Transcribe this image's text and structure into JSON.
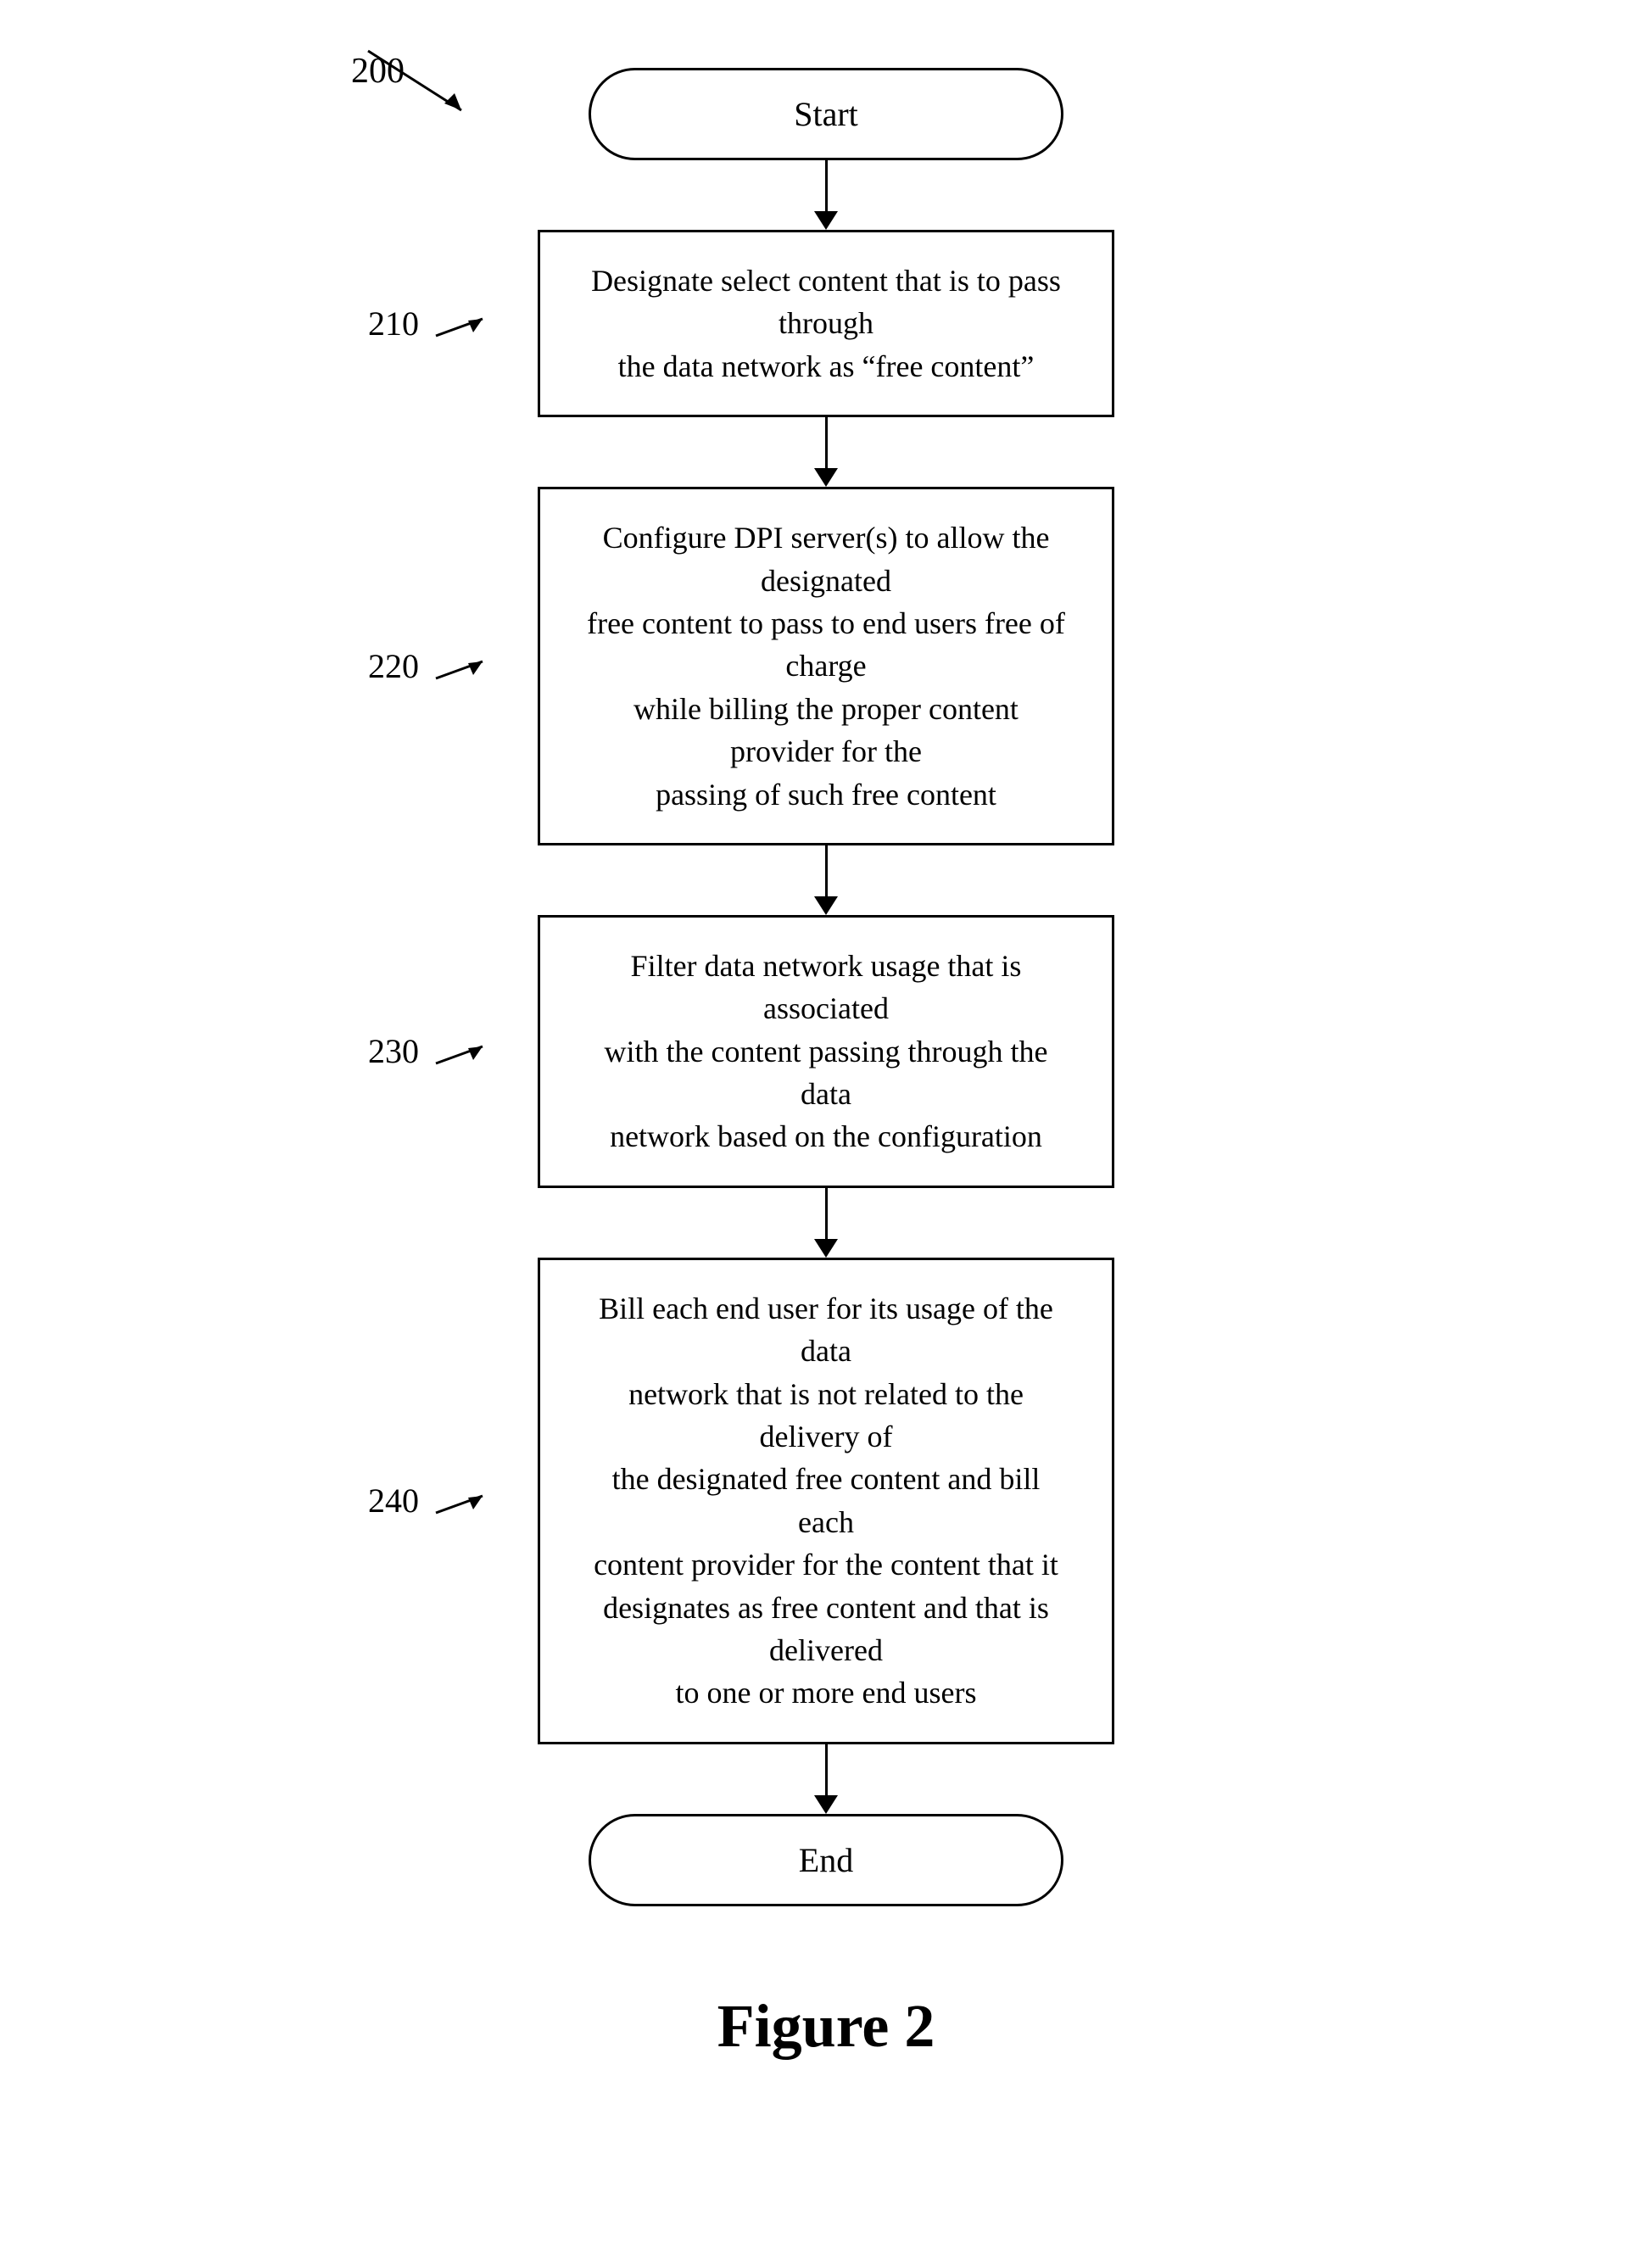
{
  "figure_label": "200",
  "figure_caption": "Figure 2",
  "nodes": {
    "start": "Start",
    "step210": {
      "label": "210",
      "text": "Designate select content that is to pass through\nthe data network as “free content”"
    },
    "step220": {
      "label": "220",
      "text": "Configure DPI server(s) to allow the designated\nfree content to pass to end users free of charge\nwhile billing the proper content provider for the\npassing of such free content"
    },
    "step230": {
      "label": "230",
      "text": "Filter data network usage that is associated\nwith the content passing through the data\nnetwork based on the configuration"
    },
    "step240": {
      "label": "240",
      "text": "Bill each end user for its usage of the data\nnetwork that is not related to the delivery of\nthe designated free content and bill each\ncontent provider for the content that it\ndesignates as free content and that is delivered\nto one or more end users"
    },
    "end": "End"
  }
}
